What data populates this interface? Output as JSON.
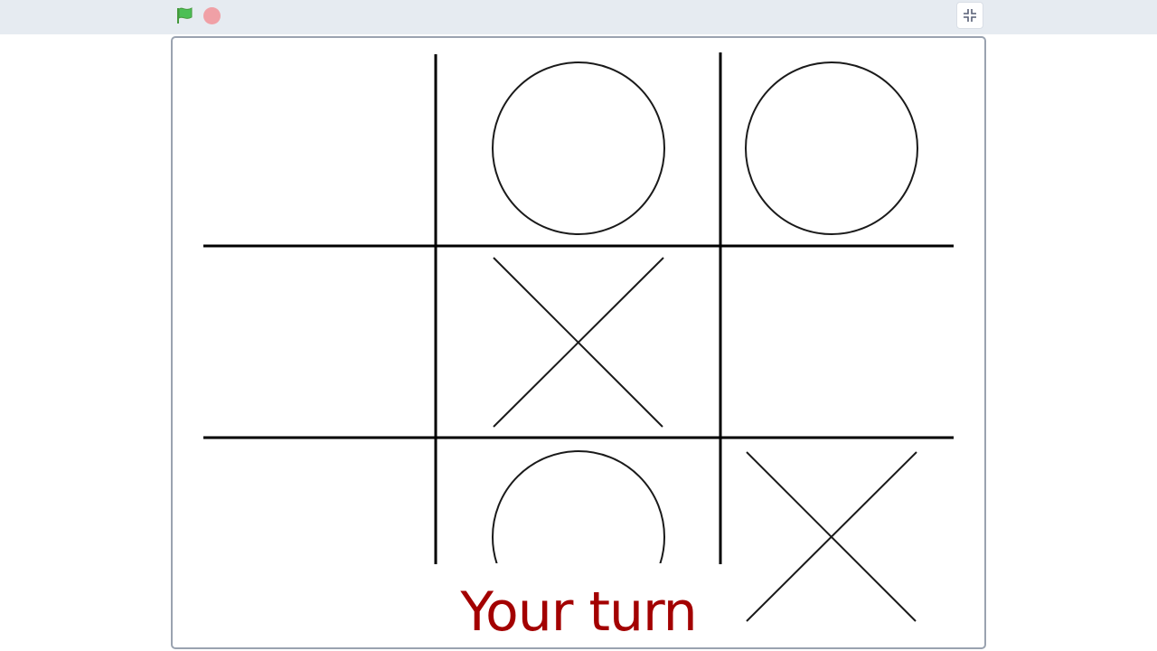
{
  "toolbar": {
    "green_flag_icon": "green-flag-icon",
    "stop_icon": "stop-icon",
    "shrink_icon": "shrink-stage-icon"
  },
  "board": {
    "cells": [
      [
        "",
        "O",
        "O"
      ],
      [
        "",
        "X",
        ""
      ],
      [
        "",
        "O",
        "X"
      ]
    ]
  },
  "status": {
    "text": "Your turn",
    "color": "#a30000"
  },
  "colors": {
    "toolbar_bg": "#e6ebf1",
    "flag_green": "#4cbf56",
    "stop_red": "#f0a0a6"
  }
}
